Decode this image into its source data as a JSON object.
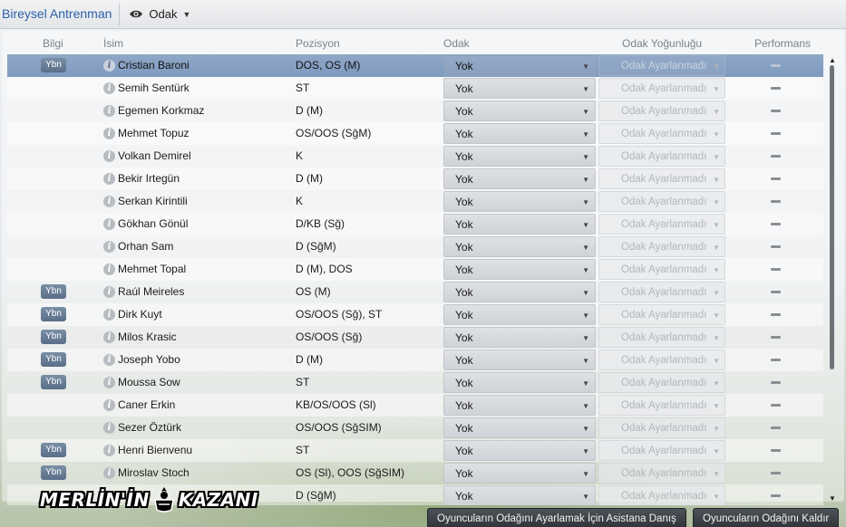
{
  "topbar": {
    "title": "Bireysel Antrenman",
    "view_label": "Odak"
  },
  "columns": {
    "info": "Bilgi",
    "name": "İsim",
    "position": "Pozisyon",
    "focus": "Odak",
    "intensity": "Odak Yoğunluğu",
    "performance": "Performans"
  },
  "badge_label": "Ybn",
  "info_glyph": "i",
  "focus_default": "Yok",
  "intensity_default": "Odak Ayarlanmadı",
  "players": [
    {
      "name": "Cristian Baroni",
      "position": "DOS, OS (M)",
      "badge": true,
      "selected": true
    },
    {
      "name": "Semih Sentürk",
      "position": "ST",
      "badge": false
    },
    {
      "name": "Egemen Korkmaz",
      "position": "D (M)",
      "badge": false
    },
    {
      "name": "Mehmet Topuz",
      "position": "OS/OOS (SğM)",
      "badge": false
    },
    {
      "name": "Volkan Demirel",
      "position": "K",
      "badge": false
    },
    {
      "name": "Bekir Irtegün",
      "position": "D (M)",
      "badge": false
    },
    {
      "name": "Serkan Kirintili",
      "position": "K",
      "badge": false
    },
    {
      "name": "Gökhan Gönül",
      "position": "D/KB (Sğ)",
      "badge": false
    },
    {
      "name": "Orhan Sam",
      "position": "D (SğM)",
      "badge": false
    },
    {
      "name": "Mehmet Topal",
      "position": "D (M), DOS",
      "badge": false
    },
    {
      "name": "Raúl Meireles",
      "position": "OS (M)",
      "badge": true
    },
    {
      "name": "Dirk Kuyt",
      "position": "OS/OOS (Sğ), ST",
      "badge": true
    },
    {
      "name": "Milos Krasic",
      "position": "OS/OOS (Sğ)",
      "badge": true
    },
    {
      "name": "Joseph Yobo",
      "position": "D (M)",
      "badge": true
    },
    {
      "name": "Moussa Sow",
      "position": "ST",
      "badge": true
    },
    {
      "name": "Caner Erkin",
      "position": "KB/OS/OOS (Sl)",
      "badge": false
    },
    {
      "name": "Sezer Öztürk",
      "position": "OS/OOS (SğSIM)",
      "badge": false
    },
    {
      "name": "Henri Bienvenu",
      "position": "ST",
      "badge": true
    },
    {
      "name": "Miroslav Stoch",
      "position": "OS (Sl), OOS (SğSIM)",
      "badge": true
    },
    {
      "name": "",
      "position": "D (SğM)",
      "badge": false
    }
  ],
  "buttons": {
    "ask_assistant": "Oyuncuların Odağını Ayarlamak İçin Asistana Danış",
    "remove_focus": "Oyuncuların Odağını Kaldır"
  },
  "watermark": {
    "left": "MERLİN'İN",
    "right": "KAZANI"
  }
}
